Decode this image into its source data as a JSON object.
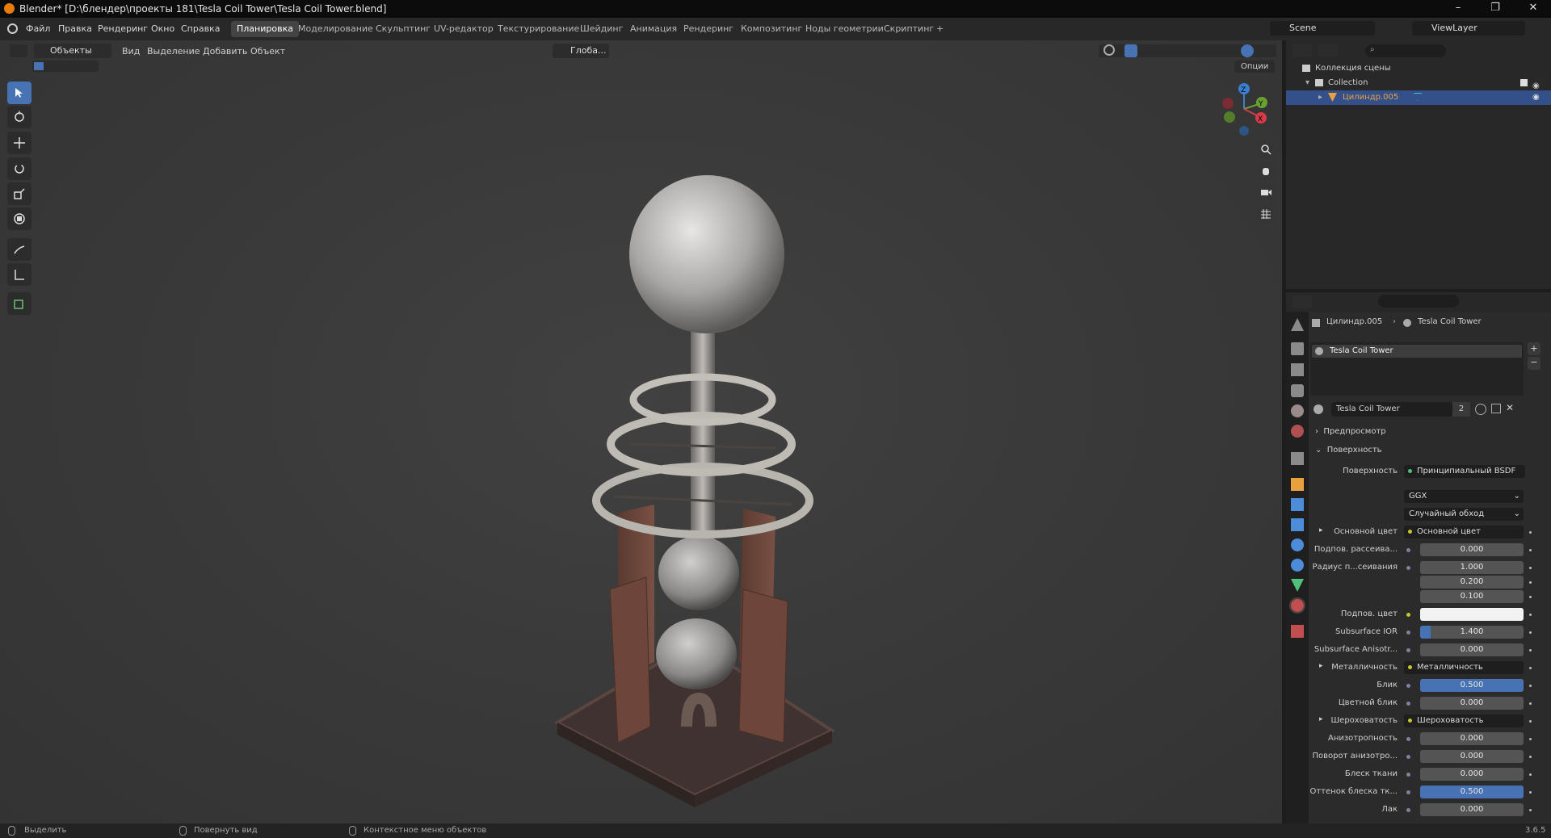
{
  "window": {
    "title": "Blender* [D:\\блендер\\проекты 181\\Tesla Coil Tower\\Tesla Coil Tower.blend]",
    "minimize": "–",
    "restore": "❐",
    "close": "✕"
  },
  "menu": [
    "Файл",
    "Правка",
    "Рендеринг",
    "Окно",
    "Справка"
  ],
  "workspaces": [
    "Планировка",
    "Моделирование",
    "Скульптинг",
    "UV-редактор",
    "Текстурирование",
    "Шейдинг",
    "Анимация",
    "Рендеринг",
    "Композитинг",
    "Ноды геометрии",
    "Скриптинг",
    "+"
  ],
  "active_workspace": "Планировка",
  "scene": {
    "name": "Scene",
    "view_layer": "ViewLayer"
  },
  "viewport": {
    "mode": "Объекты",
    "menus": [
      "Вид",
      "Выделение",
      "Добавить",
      "Объект"
    ],
    "transform_orientation": "Глоба...",
    "options": "Опции"
  },
  "gizmo": {
    "z": "Z",
    "y": "Y",
    "x": "X"
  },
  "outliner": {
    "scene_collection": "Коллекция сцены",
    "collection": "Collection",
    "object": "Цилиндр.005"
  },
  "properties": {
    "breadcrumb_object": "Цилиндр.005",
    "breadcrumb_material": "Tesla Coil Tower",
    "material_slot": "Tesla Coil Tower",
    "material_name": "Tesla Coil Tower",
    "user_count": "2",
    "sections": {
      "preview": "Предпросмотр",
      "surface": "Поверхность"
    },
    "surface_label": "Поверхность",
    "surface_value": "Принципиальный BSDF",
    "distribution": "GGX",
    "subsurface_method": "Случайный обход",
    "rows": [
      {
        "label": "Основной цвет",
        "value": "Основной цвет",
        "kind": "link"
      },
      {
        "label": "Подпов. рассеива...",
        "value": "0.000",
        "kind": "num",
        "fill": 0
      },
      {
        "label": "Радиус п...сеивания",
        "value": "1.000",
        "kind": "num",
        "fill": 0
      },
      {
        "label": "",
        "value": "0.200",
        "kind": "num",
        "fill": 0
      },
      {
        "label": "",
        "value": "0.100",
        "kind": "num",
        "fill": 0
      },
      {
        "label": "Подпов. цвет",
        "value": "",
        "kind": "color"
      },
      {
        "label": "Subsurface IOR",
        "value": "1.400",
        "kind": "num",
        "fill": 0.1
      },
      {
        "label": "Subsurface Anisotr...",
        "value": "0.000",
        "kind": "num",
        "fill": 0
      },
      {
        "label": "Металличность",
        "value": "Металличность",
        "kind": "link"
      },
      {
        "label": "Блик",
        "value": "0.500",
        "kind": "num",
        "fill": 1.0
      },
      {
        "label": "Цветной блик",
        "value": "0.000",
        "kind": "num",
        "fill": 0
      },
      {
        "label": "Шероховатость",
        "value": "Шероховатость",
        "kind": "link"
      },
      {
        "label": "Анизотропность",
        "value": "0.000",
        "kind": "num",
        "fill": 0
      },
      {
        "label": "Поворот анизотро...",
        "value": "0.000",
        "kind": "num",
        "fill": 0
      },
      {
        "label": "Блеск ткани",
        "value": "0.000",
        "kind": "num",
        "fill": 0
      },
      {
        "label": "Оттенок блеска тк...",
        "value": "0.500",
        "kind": "num",
        "fill": 1.0
      },
      {
        "label": "Лак",
        "value": "0.000",
        "kind": "num",
        "fill": 0
      }
    ]
  },
  "status": {
    "select": "Выделить",
    "rotate": "Повернуть вид",
    "context": "Контекстное меню объектов",
    "version": "3.6.5"
  },
  "colors": {
    "accent": "#4772b3",
    "selection": "#33508a",
    "object_orange": "#e8a13c"
  }
}
